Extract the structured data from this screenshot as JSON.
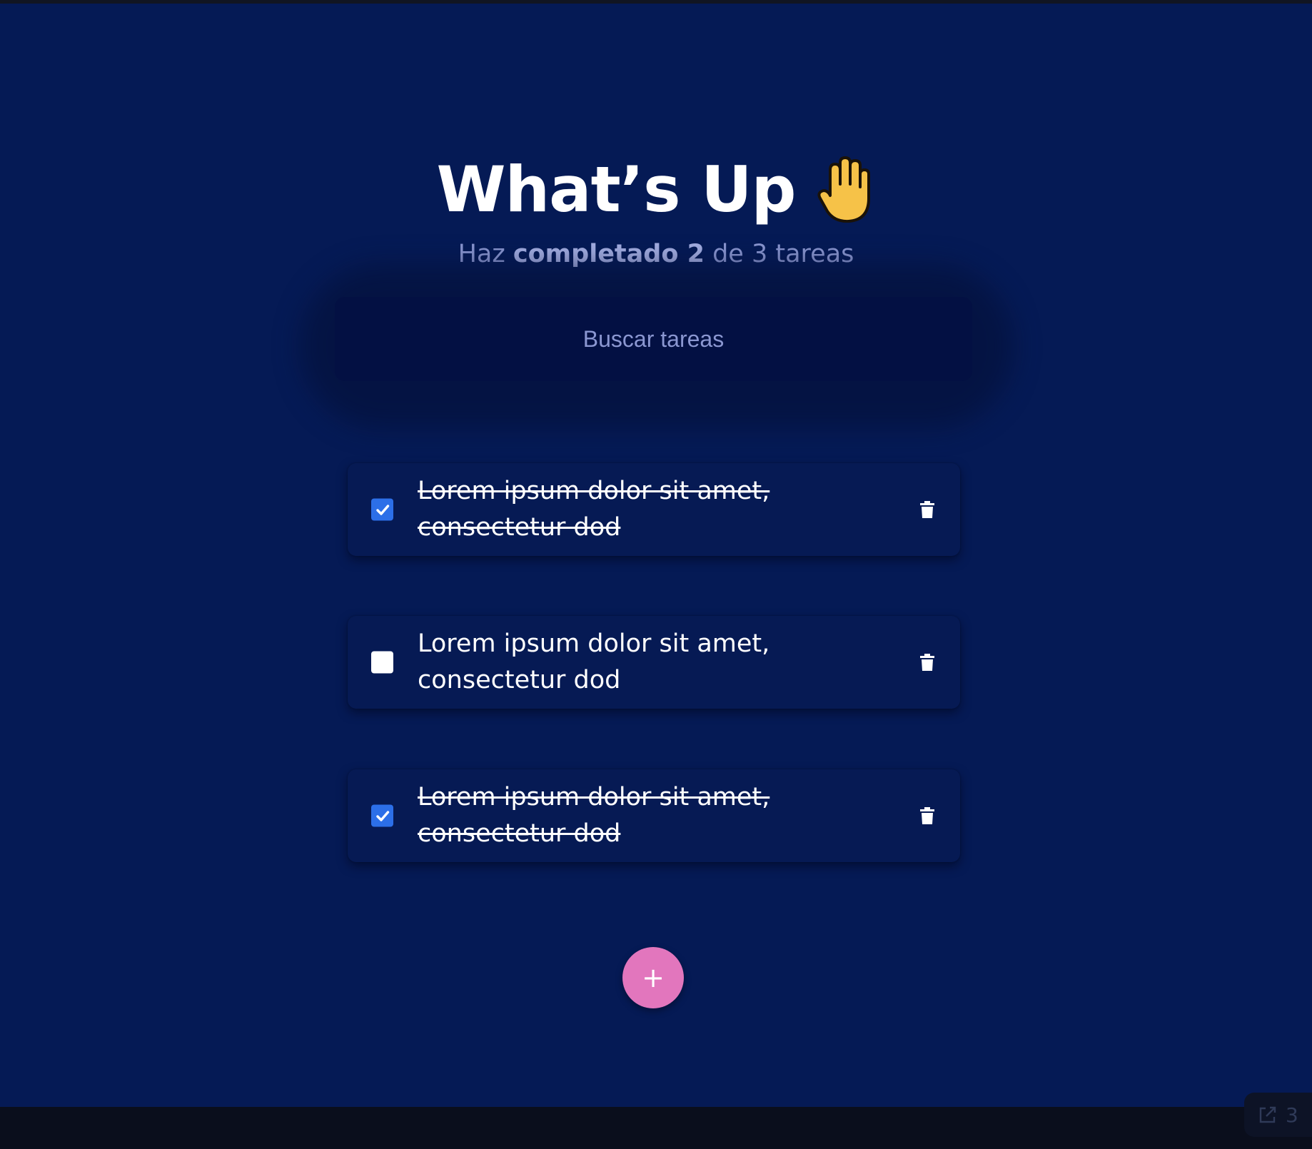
{
  "header": {
    "title": "What’s Up",
    "icon": "raised-hand-icon"
  },
  "summary": {
    "prefix": "Haz",
    "completed_label": "completado",
    "completed_count": "2",
    "middle": "de",
    "total_count": "3",
    "suffix": "tareas"
  },
  "search": {
    "placeholder": "Buscar tareas",
    "value": ""
  },
  "tasks": [
    {
      "text": "Lorem ipsum dolor sit amet, consectetur dod",
      "completed": true
    },
    {
      "text": "Lorem ipsum dolor sit amet, consectetur dod",
      "completed": false
    },
    {
      "text": "Lorem ipsum dolor sit amet, consectetur dod",
      "completed": true
    }
  ],
  "add_button": {
    "label": "+"
  },
  "status_widget": {
    "count": "3",
    "icon": "external-link-icon"
  },
  "colors": {
    "background": "#051a55",
    "search_background": "#031043",
    "checkbox_checked": "#2c6fe8",
    "add_button": "#e276bd",
    "muted_text": "#8b97d1"
  }
}
